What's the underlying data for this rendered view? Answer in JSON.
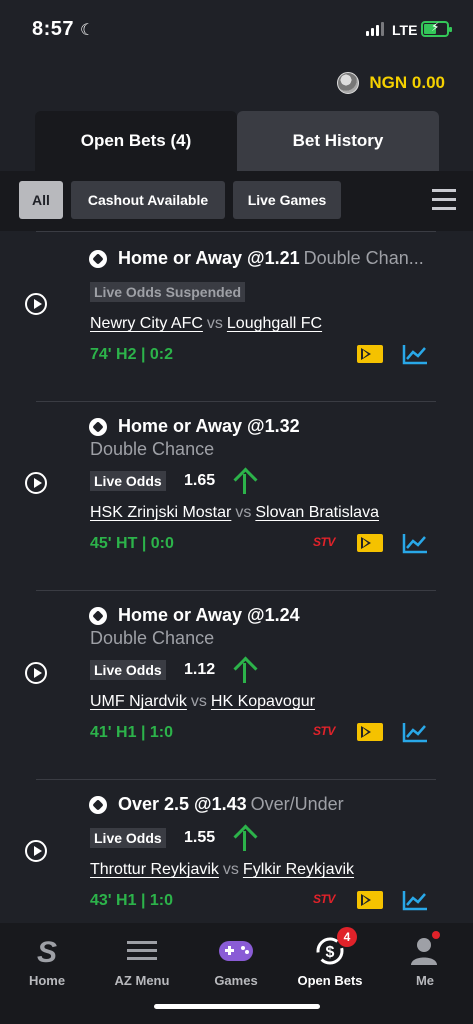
{
  "status_bar": {
    "time": "8:57",
    "network": "LTE"
  },
  "balance": {
    "text": "NGN 0.00"
  },
  "tabs": [
    {
      "label": "Open Bets (4)"
    },
    {
      "label": "Bet History"
    }
  ],
  "filters": [
    {
      "label": "All"
    },
    {
      "label": "Cashout Available"
    },
    {
      "label": "Live Games"
    }
  ],
  "bets": [
    {
      "market": "Home or Away @1.21",
      "market_type": "Double Chan...",
      "badge": "Live Odds Suspended",
      "odds": "",
      "home": "Newry City AFC",
      "vs": "vs",
      "away": "Loughgall FC",
      "score": "74' H2 | 0:2"
    },
    {
      "market": "Home or Away @1.32",
      "market_type": "Double Chance",
      "badge": "Live Odds",
      "odds": "1.65",
      "home": "HSK Zrinjski Mostar",
      "vs": "vs",
      "away": "Slovan Bratislava",
      "score": "45' HT | 0:0"
    },
    {
      "market": "Home or Away @1.24",
      "market_type": "Double Chance",
      "badge": "Live Odds",
      "odds": "1.12",
      "home": "UMF Njardvik",
      "vs": "vs",
      "away": "HK Kopavogur",
      "score": "41' H1 | 1:0"
    },
    {
      "market": "Over 2.5 @1.43",
      "market_type": "Over/Under",
      "badge": "Live Odds",
      "odds": "1.55",
      "home": "Throttur Reykjavik",
      "vs": "vs",
      "away": "Fylkir Reykjavik",
      "score": "43' H1 | 1:0"
    }
  ],
  "stv_label": "STV",
  "bottom_nav": [
    {
      "label": "Home"
    },
    {
      "label": "AZ Menu"
    },
    {
      "label": "Games"
    },
    {
      "label": "Open Bets",
      "badge": "4"
    },
    {
      "label": "Me"
    }
  ],
  "colors": {
    "accent_yellow": "#f5d100",
    "live_green": "#2cb34a",
    "alert_red": "#e0222a",
    "chart_blue": "#29a8e8"
  }
}
